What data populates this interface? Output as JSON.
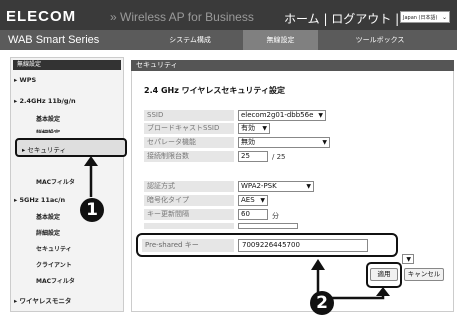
{
  "header": {
    "logo": "ELECOM",
    "tagline": "» Wireless AP for Business",
    "links": "ホーム | ログアウト |",
    "language": "Japan (日本語)"
  },
  "menubar": {
    "series": "WAB Smart Series",
    "items": [
      "システム構成",
      "無線設定",
      "ツールボックス"
    ],
    "active": "無線設定"
  },
  "sidebar": {
    "heading": "無線設定",
    "wps": "▸ WPS",
    "band24": "▸ 2.4GHz 11b/g/n",
    "basic_settings": "基本設定",
    "advanced_settings": "詳細設定",
    "security": "▸ セキュリティ",
    "mac_filter": "MACフィルタ",
    "band5": "▸ 5GHz 11ac/n",
    "basic_settings_5": "基本設定",
    "advanced_settings_5": "詳細設定",
    "security_5": "セキュリティ",
    "client": "クライアント",
    "mac_filter_5": "MACフィルタ",
    "monitor": "▸ ワイヤレスモニタ"
  },
  "main": {
    "section_header": "セキュリティ",
    "title": "2.4 GHz ワイヤレスセキュリティ設定",
    "ssid_label": "SSID",
    "ssid_value": "elecom2g01-dbb56e",
    "broadcast_label": "ブロードキャストSSID",
    "broadcast_value": "有効",
    "separator_label": "セパレータ機能",
    "separator_value": "無効",
    "max_clients_label": "接続制限台数",
    "max_clients_value": "25",
    "max_clients_unit": "/ 25",
    "auth_label": "認証方式",
    "auth_value": "WPA2-PSK",
    "enc_label": "暗号化タイプ",
    "enc_value": "AES",
    "rekey_label": "キー更新間隔",
    "rekey_value": "60",
    "rekey_unit": "分",
    "psk_label": "Pre-shared キー",
    "psk_value": "7009226445700",
    "apply": "適用",
    "cancel": "キャンセル"
  },
  "callouts": [
    "1",
    "2"
  ]
}
